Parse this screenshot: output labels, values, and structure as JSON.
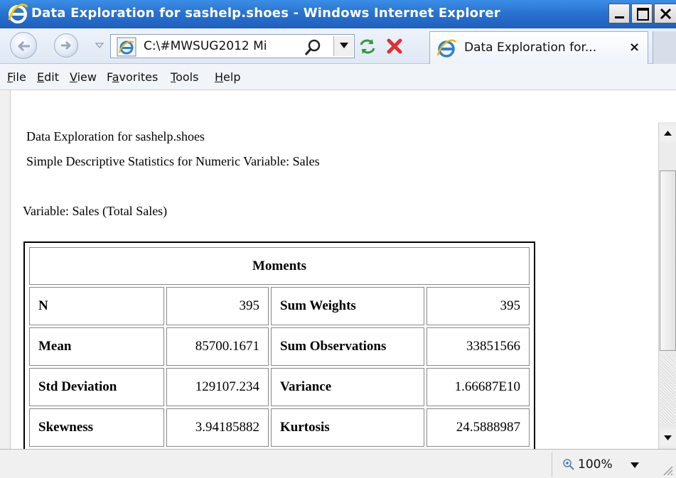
{
  "window": {
    "title": "Data Exploration for sashelp.shoes - Windows Internet Explorer"
  },
  "navbar": {
    "address": "C:\\#MWSUG2012 Mi",
    "tab_title": "Data Exploration for...",
    "tab_close": "×"
  },
  "menu": {
    "items": [
      {
        "label": "File",
        "accel": "F"
      },
      {
        "label": "Edit",
        "accel": "E"
      },
      {
        "label": "View",
        "accel": "V"
      },
      {
        "label": "Favorites",
        "accel": "a"
      },
      {
        "label": "Tools",
        "accel": "T"
      },
      {
        "label": "Help",
        "accel": "H"
      }
    ]
  },
  "content": {
    "line1": "Data Exploration for sashelp.shoes",
    "line2": "Simple Descriptive Statistics for Numeric Variable: Sales",
    "variable_line": "Variable: Sales (Total Sales)"
  },
  "moments": {
    "title": "Moments",
    "rows": [
      [
        "N",
        "395",
        "Sum Weights",
        "395"
      ],
      [
        "Mean",
        "85700.1671",
        "Sum Observations",
        "33851566"
      ],
      [
        "Std Deviation",
        "129107.234",
        "Variance",
        "1.66687E10"
      ],
      [
        "Skewness",
        "3.94185882",
        "Kurtosis",
        "24.5888987"
      ]
    ]
  },
  "status": {
    "zoom": "100%"
  },
  "colors": {
    "titlebar": "#2a73d0",
    "close_red": "#e03030",
    "refresh_green": "#2d9a3a"
  },
  "icons": [
    "ie-logo-icon",
    "back-arrow-icon",
    "forward-arrow-icon",
    "search-icon",
    "refresh-icon",
    "stop-icon",
    "zoom-icon"
  ]
}
